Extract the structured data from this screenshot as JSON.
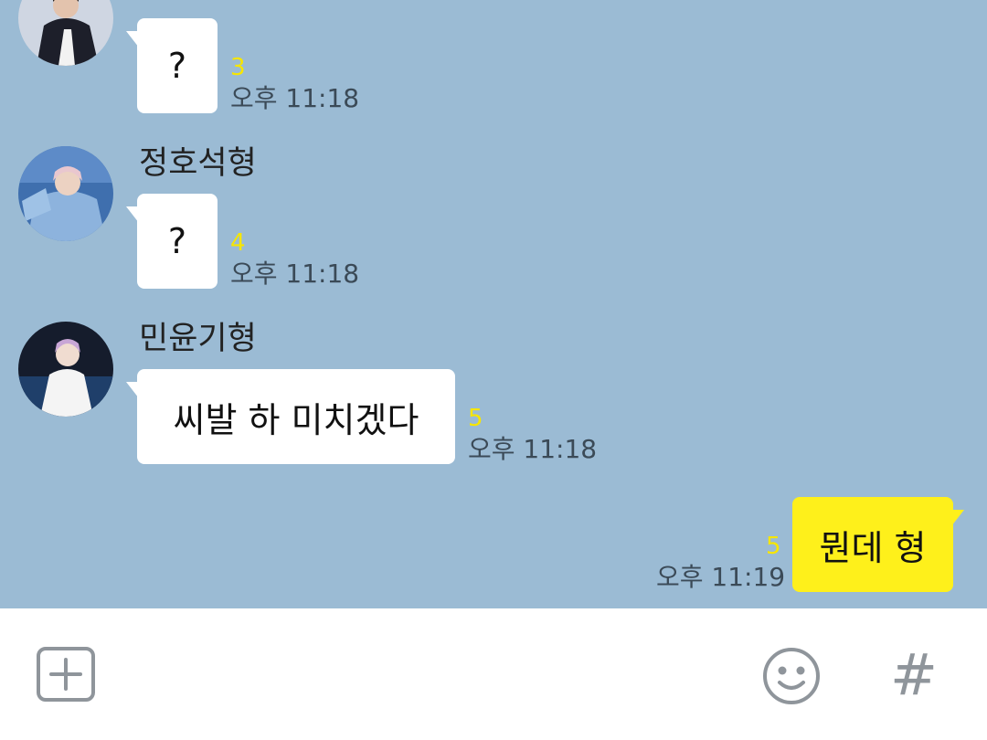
{
  "messages": [
    {
      "sender": "",
      "text": "?",
      "unread": "3",
      "time": "오후 11:18"
    },
    {
      "sender": "정호석형",
      "text": "?",
      "unread": "4",
      "time": "오후 11:18"
    },
    {
      "sender": "민윤기형",
      "text": "씨발 하 미치겠다",
      "unread": "5",
      "time": "오후 11:18"
    }
  ],
  "my_message": {
    "text": "뭔데 형",
    "unread": "5",
    "time": "오후 11:19"
  },
  "input_bar": {
    "attach_icon": "plus-square-icon",
    "emoji_icon": "smiley-icon",
    "hashtag_icon": "hashtag-icon",
    "hashtag_glyph": "#"
  },
  "colors": {
    "chat_background": "#9bbbd4",
    "my_bubble": "#fef01b",
    "their_bubble": "#ffffff",
    "unread_count": "#f7e600",
    "icon_gray": "#8f959b"
  }
}
